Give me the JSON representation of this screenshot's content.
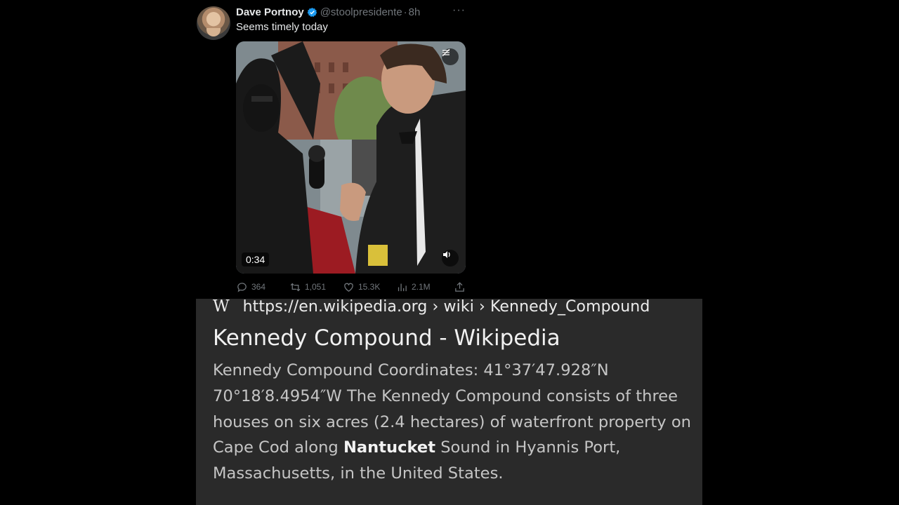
{
  "tweet": {
    "display_name": "Dave Portnoy",
    "handle": "@stoolpresidente",
    "separator": "·",
    "time": "8h",
    "more": "···",
    "text": "Seems timely today",
    "video": {
      "duration": "0:34"
    },
    "stats": {
      "replies": "364",
      "retweets": "1,051",
      "likes": "15.3K",
      "views": "2.1M"
    },
    "icons": [
      "verified-badge-icon",
      "reply-icon",
      "retweet-icon",
      "like-icon",
      "views-icon",
      "share-icon",
      "volume-icon",
      "sensitive-icon"
    ],
    "colors": {
      "verified": "#1d9bf0",
      "muted_text": "#71767b"
    }
  },
  "search_result": {
    "site_icon": "W",
    "url": "https://en.wikipedia.org › wiki › Kennedy_Compound",
    "title": "Kennedy Compound - Wikipedia",
    "snippet_before": "Kennedy Compound Coordinates: 41°37′47.928″N 70°18′8.4954″W The Kennedy Compound consists of three houses on six acres (2.4 hectares) of waterfront property on Cape Cod along ",
    "snippet_bold": "Nantucket",
    "snippet_after": " Sound in Hyannis Port, Massachusetts, in the United States.",
    "colors": {
      "background": "#2a2a2a",
      "text": "#c5c5c5"
    }
  }
}
